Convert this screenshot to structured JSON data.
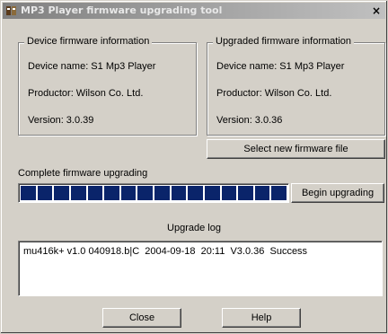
{
  "window": {
    "title": "MP3 Player firmware upgrading tool",
    "close_glyph": "×"
  },
  "device_info": {
    "legend": "Device firmware information",
    "name": "Device name: S1 Mp3 Player",
    "productor": "Productor: Wilson Co. Ltd.",
    "version": "Version: 3.0.39"
  },
  "upgraded_info": {
    "legend": "Upgraded firmware information",
    "name": "Device name: S1 Mp3 Player",
    "productor": "Productor: Wilson Co. Ltd.",
    "version": "Version: 3.0.36"
  },
  "select_button": "Select new firmware file",
  "progress": {
    "label": "Complete firmware upgrading",
    "filled_segments": 16,
    "total_segments": 16,
    "fill_color": "#0a246a"
  },
  "begin_button": "Begin upgrading",
  "log": {
    "title": "Upgrade log",
    "lines": [
      "mu416k+ v1.0 040918.b|C  2004-09-18  20:11  V3.0.36  Success"
    ]
  },
  "close_button": "Close",
  "help_button": "Help"
}
